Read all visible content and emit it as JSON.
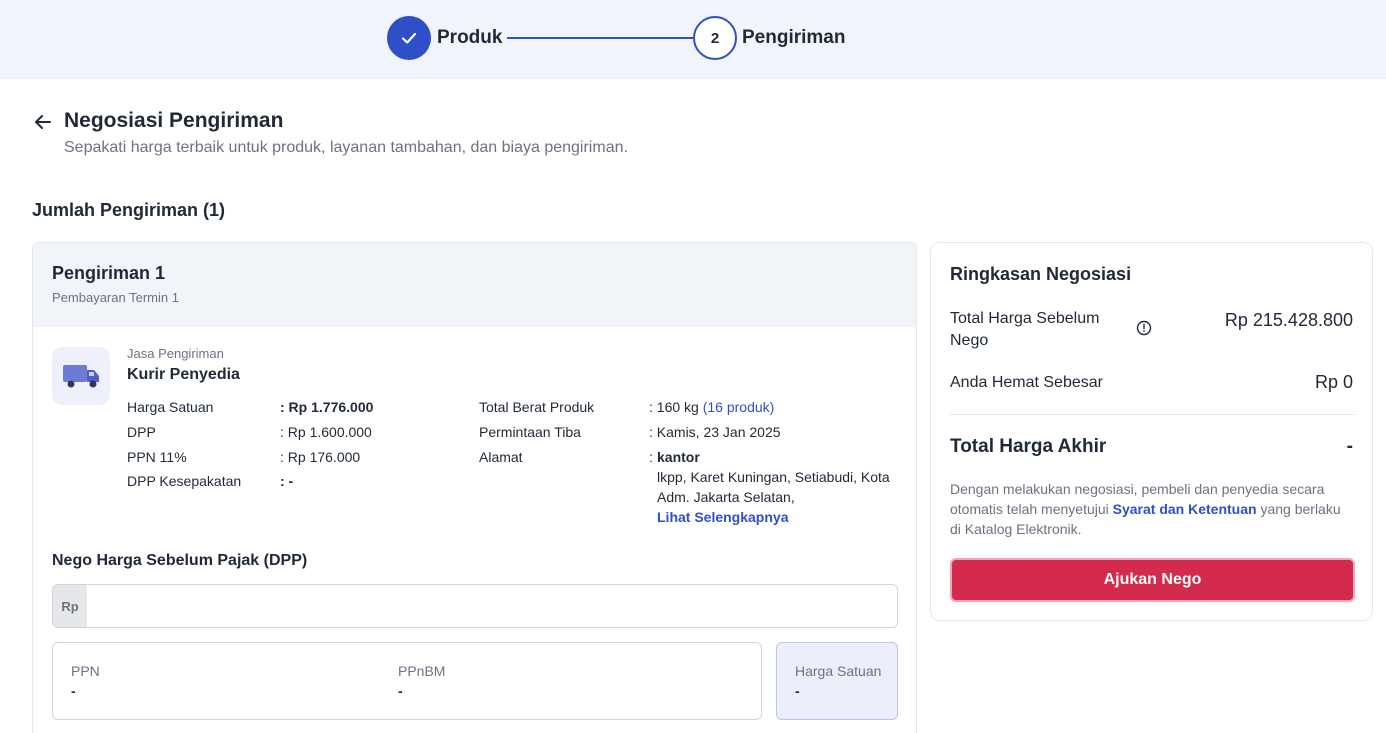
{
  "stepper": {
    "step1_label": "Produk",
    "step2_number": "2",
    "step2_label": "Pengiriman"
  },
  "header": {
    "title": "Negosiasi Pengiriman",
    "subtitle": "Sepakati harga terbaik untuk produk, layanan tambahan, dan biaya pengiriman."
  },
  "section_title": "Jumlah Pengiriman (1)",
  "shipment": {
    "title": "Pengiriman 1",
    "subtitle": "Pembayaran Termin 1",
    "service_label": "Jasa Pengiriman",
    "service_name": "Kurir Penyedia",
    "left_details": [
      {
        "label": "Harga Satuan",
        "value": ": Rp 1.776.000"
      },
      {
        "label": "DPP",
        "value": ": Rp 1.600.000"
      },
      {
        "label": "PPN 11%",
        "value": ": Rp 176.000"
      },
      {
        "label": "DPP Kesepakatan",
        "value": ": -"
      }
    ],
    "right_details": {
      "weight_label": "Total Berat Produk",
      "weight_value": ": 160 kg",
      "weight_link": "(16 produk)",
      "arrival_label": "Permintaan Tiba",
      "arrival_value": ": Kamis, 23 Jan 2025",
      "address_label": "Alamat",
      "address_name": "kantor",
      "address_colon": ":",
      "address_line1": "lkpp, Karet Kuningan, Setiabudi, Kota",
      "address_line2": "Adm. Jakarta Selatan,",
      "address_link": "Lihat Selengkapnya"
    },
    "nego_label": "Nego Harga Sebelum Pajak (DPP)",
    "nego_prefix": "Rp",
    "nego_value": "",
    "ppn_label": "PPN",
    "ppn_value": "-",
    "ppnbm_label": "PPnBM",
    "ppnbm_value": "-",
    "unit_price_label": "Harga Satuan",
    "unit_price_value": "-"
  },
  "summary": {
    "title": "Ringkasan Negosiasi",
    "before_label_line1": "Total Harga Sebelum",
    "before_label_line2": "Nego",
    "before_value": "Rp 215.428.800",
    "saved_label": "Anda Hemat Sebesar",
    "saved_value": "Rp 0",
    "total_label": "Total Harga Akhir",
    "total_value": "-",
    "terms_prefix": "Dengan melakukan negosiasi, pembeli dan penyedia secara otomatis telah menyetujui ",
    "terms_link": "Syarat dan Ketentuan",
    "terms_suffix": " yang berlaku di Katalog Elektronik.",
    "submit_label": "Ajukan Nego"
  },
  "colors": {
    "primary": "#2f4fc8",
    "danger": "#d42a4e",
    "stepper_bg": "#f1f5fb"
  }
}
